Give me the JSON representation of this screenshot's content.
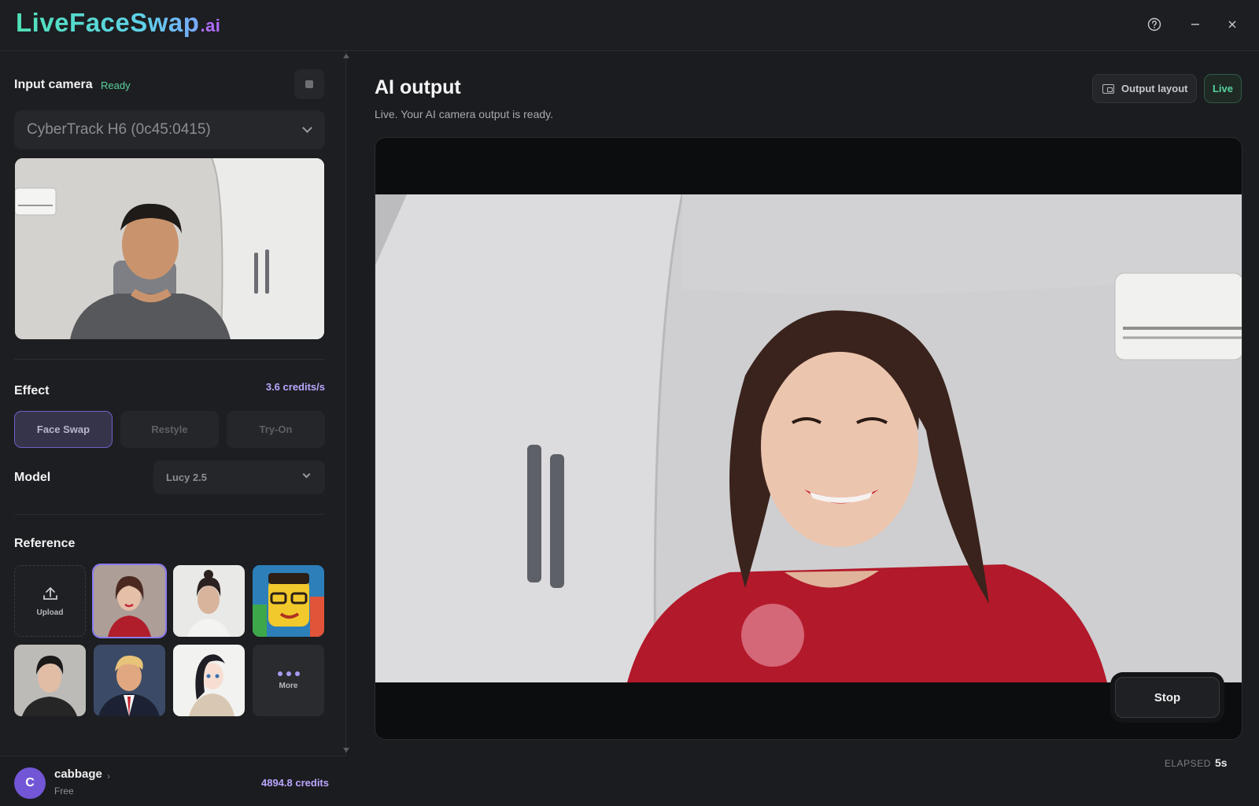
{
  "app": {
    "logo_main": "LiveFaceSwap",
    "logo_suffix": ".ai",
    "icons": [
      "help-icon",
      "minimize-icon",
      "close-icon"
    ]
  },
  "sidebar": {
    "input_camera": {
      "title": "Input camera",
      "status": "Ready",
      "selected_camera": "CyberTrack H6 (0c45:0415)"
    },
    "effect": {
      "title": "Effect",
      "credits_rate": "3.6 credits/s",
      "tabs": [
        {
          "label": "Face Swap",
          "active": true
        },
        {
          "label": "Restyle",
          "active": false
        },
        {
          "label": "Try-On",
          "active": false
        }
      ]
    },
    "model": {
      "title": "Model",
      "selected": "Lucy 2.5"
    },
    "reference": {
      "title": "Reference",
      "upload_label": "Upload",
      "more_label": "More",
      "selected_index": 0
    },
    "user": {
      "initial": "C",
      "name": "cabbage",
      "plan": "Free",
      "credits": "4894.8 credits"
    }
  },
  "main": {
    "title": "AI output",
    "subtitle": "Live. Your AI camera output is ready.",
    "output_layout_label": "Output layout",
    "live_label": "Live",
    "stop_label": "Stop",
    "elapsed_label": "ELAPSED",
    "elapsed_value": "5s"
  },
  "colors": {
    "accent": "#8a7cf0",
    "live_green": "#57d49c",
    "credits_purple": "#b9a7ff",
    "background": "#1b1c1f"
  }
}
